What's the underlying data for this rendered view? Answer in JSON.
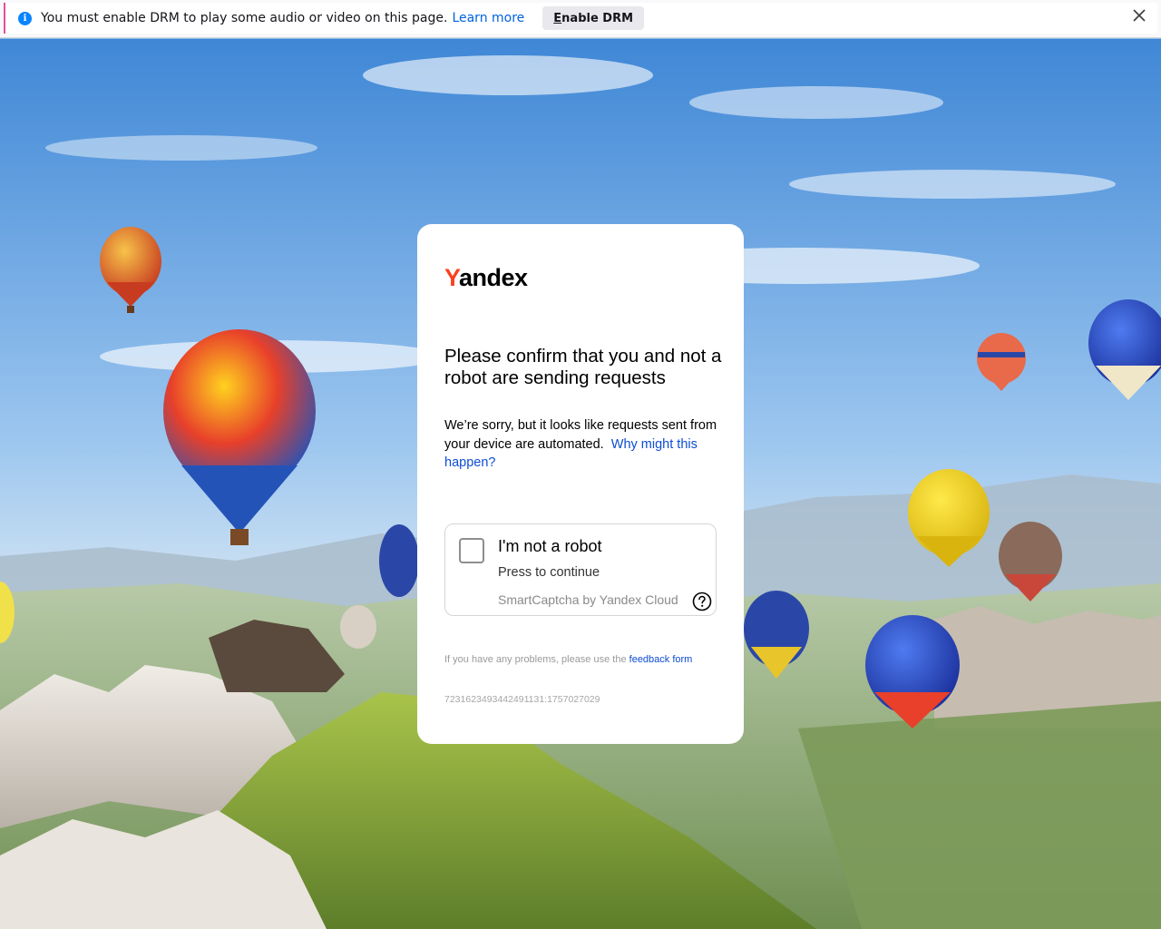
{
  "drm_bar": {
    "message": "You must enable DRM to play some audio or video on this page.",
    "learn_more": "Learn more",
    "enable_button_prefix": "E",
    "enable_button_rest": "nable DRM",
    "accent_color": "#0a84ff"
  },
  "card": {
    "logo_first": "Y",
    "logo_rest": "andex",
    "logo_color": "#fc3f1d",
    "title": "Please confirm that you and not a robot are sending requests",
    "description": "We’re sorry, but it looks like requests sent from your device are automated.",
    "why_link": "Why might this happen?",
    "captcha": {
      "checkbox_label": "I'm not a robot",
      "subtitle": "Press to continue",
      "brand": "SmartCaptcha by Yandex Cloud"
    },
    "footer_text": "If you have any problems, please use the",
    "footer_link": "feedback form",
    "request_id": "7231623493442491131:1757027029"
  },
  "icons": {
    "info": "info-icon",
    "close": "close-icon",
    "help": "question-circle-icon"
  }
}
